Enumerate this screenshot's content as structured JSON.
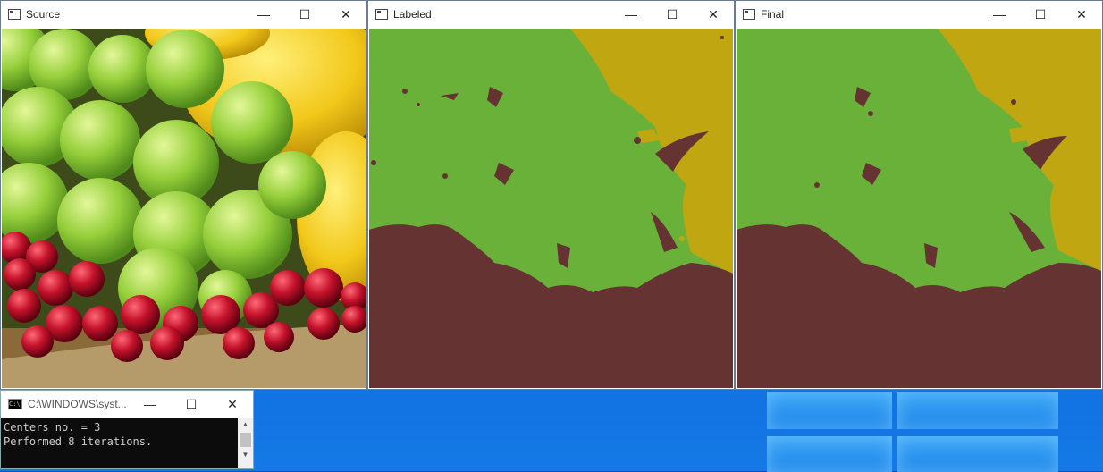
{
  "windows": {
    "source": {
      "title": "Source"
    },
    "labeled": {
      "title": "Labeled"
    },
    "final": {
      "title": "Final"
    }
  },
  "controls": {
    "minimize": "—",
    "maximize": "☐",
    "close": "✕"
  },
  "console": {
    "title": "C:\\WINDOWS\\syst...",
    "icon_text": "C:\\",
    "lines": [
      "Centers no. = 3",
      "Performed 8 iterations."
    ]
  },
  "colors": {
    "green": "#6ab13a",
    "brown": "#663333",
    "olive": "#c0a712"
  }
}
